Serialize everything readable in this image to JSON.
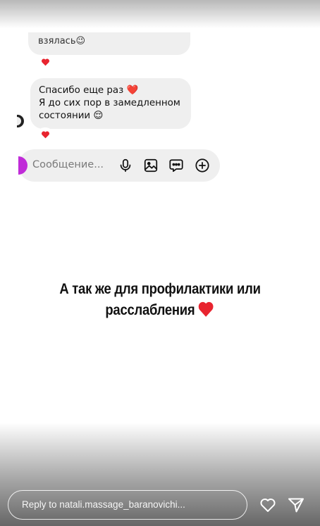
{
  "chat": {
    "partial_message": "взялась😉",
    "message_lines": [
      "Спасибо еще раз ❤️",
      "Я до сих пор в замедленном",
      "состоянии 😌"
    ],
    "reaction_icon": "red-heart-reaction-icon"
  },
  "composer": {
    "placeholder": "Сообщение...",
    "icons": [
      "microphone-icon",
      "gallery-icon",
      "sticker-chat-icon",
      "add-circle-icon"
    ],
    "avatar_color": "#c02bd8"
  },
  "caption": {
    "line1": "А так же для профилактики или",
    "line2": "расслабления",
    "emoji": "red-heart-icon"
  },
  "story_footer": {
    "reply_placeholder": "Reply to natali.massage_baranovichi...",
    "icons": [
      "like-heart-icon",
      "share-send-icon"
    ]
  },
  "colors": {
    "heart_red": "#e8242f",
    "bubble_gray": "#efefef",
    "text_dark": "#111111"
  }
}
